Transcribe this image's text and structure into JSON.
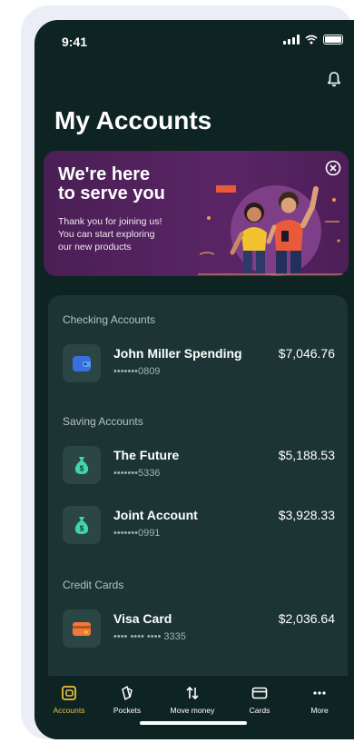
{
  "status_bar": {
    "time": "9:41"
  },
  "header": {
    "title": "My Accounts",
    "bell_icon": "bell-icon"
  },
  "banner": {
    "title": "We're here\nto serve you",
    "text": "Thank you for joining us!\nYou can start exploring\nour new products",
    "close_icon": "close-circle-icon"
  },
  "sections": {
    "checking": {
      "label": "Checking Accounts",
      "accounts": [
        {
          "name": "John Miller Spending",
          "number": "•••••••0809",
          "balance": "$7,046.76",
          "icon": "wallet-icon"
        }
      ]
    },
    "saving": {
      "label": "Saving Accounts",
      "accounts": [
        {
          "name": "The Future",
          "number": "•••••••5336",
          "balance": "$5,188.53",
          "icon": "money-bag-icon"
        },
        {
          "name": "Joint Account",
          "number": "•••••••0991",
          "balance": "$3,928.33",
          "icon": "money-bag-icon"
        }
      ]
    },
    "credit": {
      "label": "Credit Cards",
      "accounts": [
        {
          "name": "Visa Card",
          "number": "•••• •••• •••• 3335",
          "balance": "$2,036.64",
          "icon": "credit-card-icon"
        }
      ]
    }
  },
  "tabbar": {
    "items": [
      {
        "label": "Accounts",
        "icon": "accounts-icon",
        "active": true
      },
      {
        "label": "Pockets",
        "icon": "pockets-icon",
        "active": false
      },
      {
        "label": "Move money",
        "icon": "transfer-icon",
        "active": false
      },
      {
        "label": "Cards",
        "icon": "card-icon",
        "active": false
      },
      {
        "label": "More",
        "icon": "more-icon",
        "active": false
      }
    ]
  },
  "colors": {
    "background": "#0e2423",
    "panel": "#1c3534",
    "accent_active": "#e8c23c",
    "banner": "#5a2565"
  }
}
